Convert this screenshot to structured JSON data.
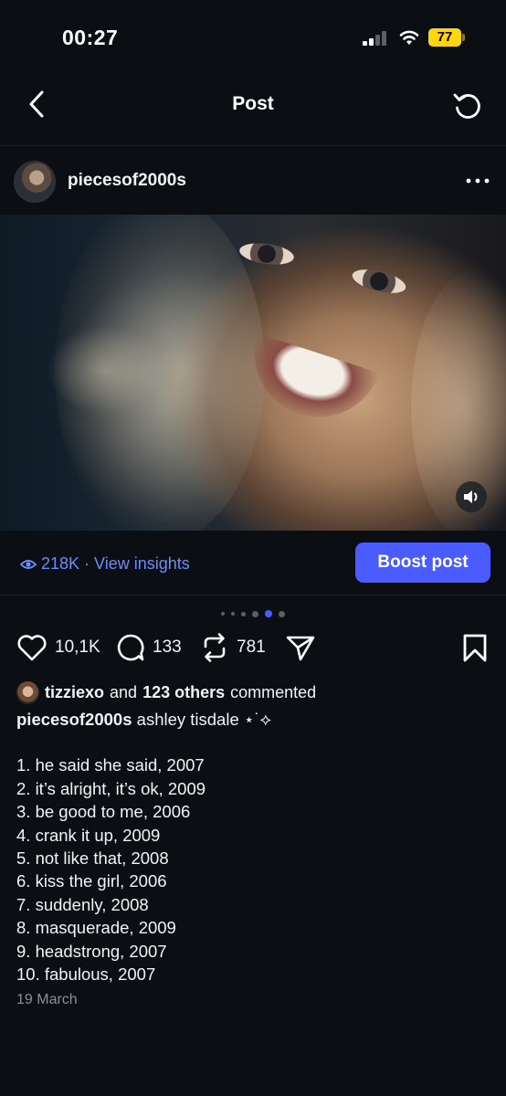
{
  "status_bar": {
    "time": "00:27",
    "battery_level": "77",
    "battery_color": "#ffd60a"
  },
  "header": {
    "title": "Post",
    "back_icon": "chevron-left-icon",
    "refresh_icon": "refresh-icon"
  },
  "author": {
    "username": "piecesof2000s",
    "more_icon": "ellipsis-icon"
  },
  "media": {
    "mute_icon": "speaker-icon"
  },
  "insights": {
    "views": "218K",
    "separator": "·",
    "link_label": "View insights",
    "boost_label": "Boost post",
    "accent_color": "#4a5cff"
  },
  "carousel": {
    "total": 6,
    "active_index": 4
  },
  "actions": {
    "likes": "10,1K",
    "comments": "133",
    "reposts": "781"
  },
  "caption": {
    "commenter": "tizziexo",
    "and_text": "and",
    "others": "123 others",
    "commented_text": "commented",
    "author": "piecesof2000s",
    "text": "ashley tisdale ⋆˙⟡",
    "list": [
      "1. he said she said, 2007",
      "2. it’s alright, it’s ok, 2009",
      "3. be good to me, 2006",
      "4. crank it up, 2009",
      "5. not like that, 2008",
      "6. kiss the girl, 2006",
      "7. suddenly, 2008",
      "8. masquerade, 2009",
      "9. headstrong, 2007",
      "10. fabulous, 2007"
    ],
    "date": "19 March"
  }
}
